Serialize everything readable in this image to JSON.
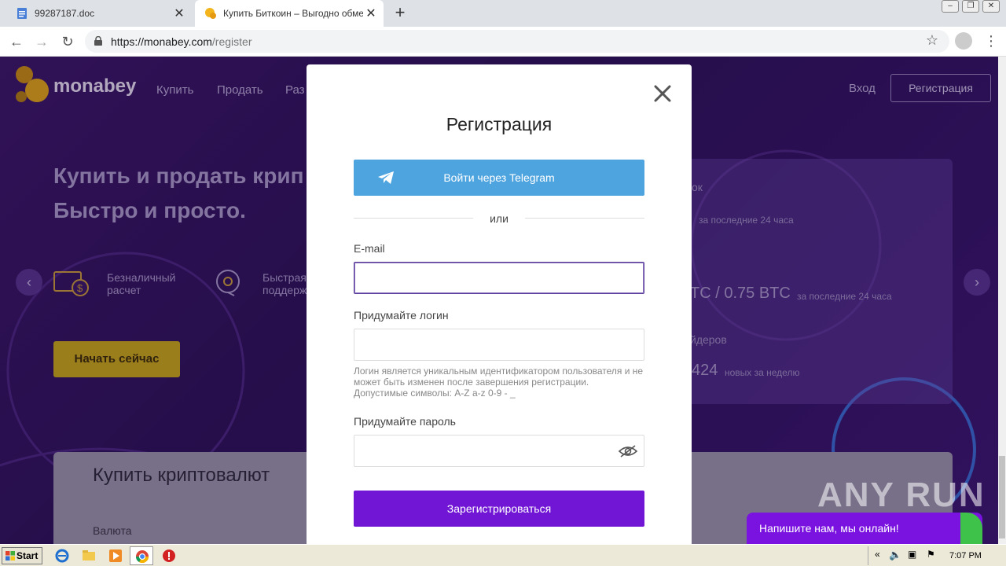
{
  "browser": {
    "tabs": [
      {
        "title": "99287187.doc",
        "icon": "document-icon"
      },
      {
        "title": "Купить Биткоин – Выгодно обмена",
        "icon": "monabey-favicon-icon"
      }
    ],
    "url_host": "https://monabey.com",
    "url_path": "/register"
  },
  "site": {
    "logo_text": "monabey",
    "nav": [
      "Купить",
      "Продать",
      "Раз"
    ],
    "login": "Вход",
    "register": "Регистрация",
    "hero_line1": "Купить и продать крип",
    "hero_line2": "Быстро и просто.",
    "feature1_line1": "Безналичный",
    "feature1_line2": "расчет",
    "feature2_line1": "Быстрая",
    "feature2_line2": "поддерж",
    "start_button": "Начать сейчас",
    "stats": {
      "label1": "ок",
      "sub1": "за последние 24 часа",
      "big2": "TC / 0.75 BTC",
      "sub2": "за последние 24 часа",
      "label3": "йдеров",
      "big3": "424",
      "sub3": "новых за неделю"
    },
    "buy_title": "Купить криптовалют",
    "buy_currency_label": "Валюта",
    "chat_widget": "Напишите нам, мы онлайн!",
    "watermark": "ANY RUN"
  },
  "modal": {
    "title": "Регистрация",
    "telegram_button": "Войти через Telegram",
    "divider": "или",
    "email_label": "E-mail",
    "email_value": "",
    "login_label": "Придумайте логин",
    "login_value": "",
    "login_hint": "Логин является уникальным идентификатором пользователя и не может быть изменен после завершения регистрации. Допустимые символы: A-Z a-z 0-9 - _",
    "password_label": "Придумайте пароль",
    "password_value": "",
    "submit": "Зарегистрироваться"
  },
  "taskbar": {
    "start": "Start",
    "clock": "7:07 PM"
  },
  "colors": {
    "purple_button": "#7216d6",
    "telegram_blue": "#4ea4df",
    "start_yellow": "#c8a418"
  }
}
